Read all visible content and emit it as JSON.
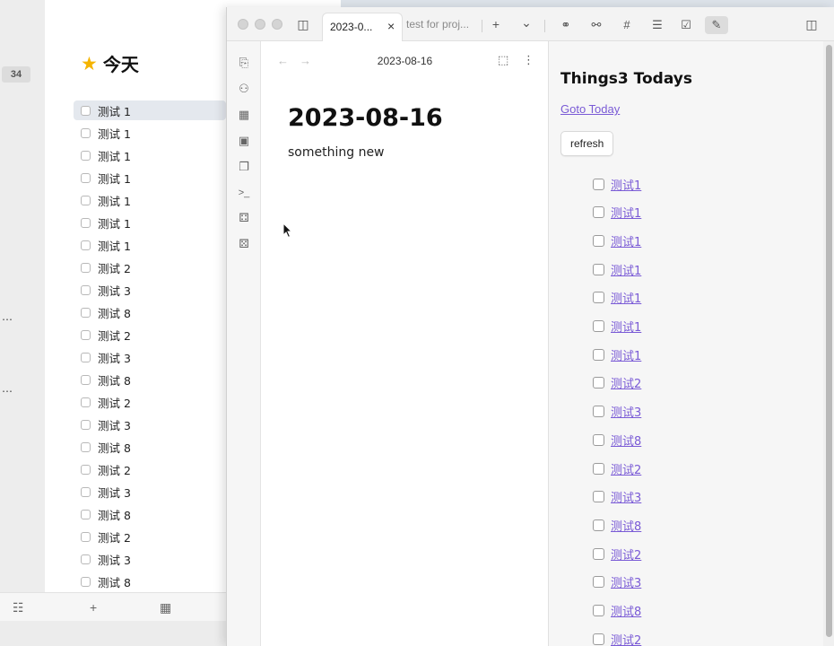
{
  "things": {
    "badge": "34",
    "truncated": [
      "…",
      "…"
    ],
    "title": "今天",
    "todos": [
      "测试 1",
      "测试 1",
      "测试 1",
      "测试 1",
      "测试 1",
      "测试 1",
      "测试 1",
      "测试 2",
      "测试 3",
      "测试 8",
      "测试 2",
      "测试 3",
      "测试 8",
      "测试 2",
      "测试 3",
      "测试 8",
      "测试 2",
      "测试 3",
      "测试 8",
      "测试 2",
      "测试 3",
      "测试 8"
    ],
    "bottom_icons": [
      "filter-icon",
      "plus-icon",
      "calendar-icon"
    ],
    "bottom_glyphs": [
      "☷",
      "+",
      "▦"
    ]
  },
  "obsidian": {
    "tabs": [
      {
        "label": "2023-0...",
        "active": true
      },
      {
        "label": "test for proj...",
        "active": false
      }
    ],
    "glyphs": {
      "sidebar_toggle": "◫",
      "close": "×",
      "new_tab": "+",
      "tab_list": "⌄",
      "back": "←",
      "forward": "→",
      "reading": "⬚",
      "more": "⋮",
      "right_toggle": "◫"
    },
    "right_toolbar": [
      {
        "name": "link-icon",
        "glyph": "⚭"
      },
      {
        "name": "outgoing-link-icon",
        "glyph": "⚯"
      },
      {
        "name": "tag-icon",
        "glyph": "#"
      },
      {
        "name": "outline-icon",
        "glyph": "☰"
      },
      {
        "name": "calendar-check-icon",
        "glyph": "☑"
      },
      {
        "name": "pencil-icon",
        "glyph": "✎"
      }
    ],
    "ribbon": [
      {
        "name": "file-plus-icon",
        "glyph": "⎘"
      },
      {
        "name": "graph-icon",
        "glyph": "⚇"
      },
      {
        "name": "grid-icon",
        "glyph": "▦"
      },
      {
        "name": "calendar-icon",
        "glyph": "▣"
      },
      {
        "name": "copy-icon",
        "glyph": "❐"
      },
      {
        "name": "terminal-icon",
        "glyph": ">_"
      },
      {
        "name": "dice-icon",
        "glyph": "⚃"
      },
      {
        "name": "dice-alt-icon",
        "glyph": "⚄"
      }
    ],
    "editor": {
      "view_title": "2023-08-16",
      "heading": "2023-08-16",
      "body": "something new"
    },
    "panel": {
      "title": "Things3 Todays",
      "goto_link": "Goto Today",
      "refresh_label": "refresh",
      "items": [
        "测试1",
        "测试1",
        "测试1",
        "测试1",
        "测试1",
        "测试1",
        "测试1",
        "测试2",
        "测试3",
        "测试8",
        "测试2",
        "测试3",
        "测试8",
        "测试2",
        "测试3",
        "测试8",
        "测试2"
      ]
    }
  },
  "colors": {
    "link": "#7a5bd6",
    "star": "#f5b400"
  }
}
